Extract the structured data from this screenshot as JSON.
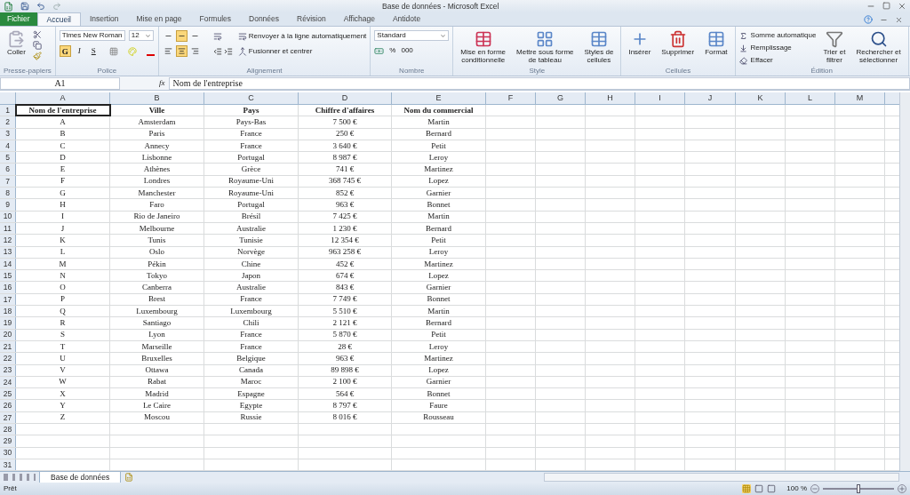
{
  "window": {
    "title": "Base de données - Microsoft Excel"
  },
  "tabs": [
    {
      "label": "Fichier",
      "selected": false,
      "kind": "file"
    },
    {
      "label": "Accueil",
      "selected": true,
      "kind": "tab"
    },
    {
      "label": "Insertion",
      "selected": false,
      "kind": "tab"
    },
    {
      "label": "Mise en page",
      "selected": false,
      "kind": "tab"
    },
    {
      "label": "Formules",
      "selected": false,
      "kind": "tab"
    },
    {
      "label": "Données",
      "selected": false,
      "kind": "tab"
    },
    {
      "label": "Révision",
      "selected": false,
      "kind": "tab"
    },
    {
      "label": "Affichage",
      "selected": false,
      "kind": "tab"
    },
    {
      "label": "Antidote",
      "selected": false,
      "kind": "tab"
    }
  ],
  "ribbon": {
    "clipboard": {
      "title": "Presse-papiers",
      "paste": "Coller"
    },
    "font": {
      "title": "Police",
      "font_name": "Times New Roman",
      "font_size": "12",
      "styles": [
        {
          "label": "G",
          "on": true
        },
        {
          "label": "I",
          "on": false
        },
        {
          "label": "S",
          "on": false
        }
      ]
    },
    "alignment": {
      "title": "Alignement",
      "vertical": [
        {
          "on": false
        },
        {
          "on": true
        },
        {
          "on": false
        }
      ],
      "horizontal": [
        {
          "on": false
        },
        {
          "on": true
        },
        {
          "on": false
        }
      ],
      "wrap": "Renvoyer à la ligne automatiquement",
      "merge": "Fusionner et centrer"
    },
    "number": {
      "title": "Nombre",
      "format": "Standard",
      "percent": "%",
      "thousands": "000"
    },
    "style": {
      "title": "Style",
      "buttons": [
        {
          "lines": [
            "Mise en forme",
            "conditionnelle"
          ]
        },
        {
          "lines": [
            "Mettre sous forme",
            "de tableau"
          ]
        },
        {
          "lines": [
            "Styles de",
            "cellules"
          ]
        }
      ]
    },
    "cells": {
      "title": "Cellules",
      "buttons": [
        "Insérer",
        "Supprimer",
        "Format"
      ]
    },
    "editing": {
      "title": "Édition",
      "small": [
        "Somme automatique",
        "Remplissage",
        "Effacer"
      ],
      "big": [
        {
          "lines": [
            "Trier et",
            "filtrer"
          ]
        },
        {
          "lines": [
            "Rechercher et",
            "sélectionner"
          ]
        }
      ]
    }
  },
  "formula_bar": {
    "name_box": "A1",
    "fx": "fx",
    "value": "Nom de l'entreprise"
  },
  "sheet": {
    "columns": [
      "A",
      "B",
      "C",
      "D",
      "E",
      "F",
      "G",
      "H",
      "I",
      "J",
      "K",
      "L",
      "M"
    ],
    "row_numbers": [
      "1",
      "2",
      "3",
      "4",
      "5",
      "6",
      "7",
      "8",
      "9",
      "10",
      "11",
      "12",
      "13",
      "14",
      "15",
      "16",
      "17",
      "18",
      "19",
      "20",
      "21",
      "22",
      "23",
      "24",
      "25",
      "26",
      "27",
      "28",
      "29",
      "30",
      "31"
    ],
    "rows": [
      [
        "Nom de l'entreprise",
        "Ville",
        "Pays",
        "Chiffre d'affaires",
        "Nom du commercial"
      ],
      [
        "A",
        "Amsterdam",
        "Pays-Bas",
        "7 500 €",
        "Martin"
      ],
      [
        "B",
        "Paris",
        "France",
        "250 €",
        "Bernard"
      ],
      [
        "C",
        "Annecy",
        "France",
        "3 640 €",
        "Petit"
      ],
      [
        "D",
        "Lisbonne",
        "Portugal",
        "8 987 €",
        "Leroy"
      ],
      [
        "E",
        "Athènes",
        "Grèce",
        "741 €",
        "Martinez"
      ],
      [
        "F",
        "Londres",
        "Royaume-Uni",
        "368 745 €",
        "Lopez"
      ],
      [
        "G",
        "Manchester",
        "Royaume-Uni",
        "852 €",
        "Garnier"
      ],
      [
        "H",
        "Faro",
        "Portugal",
        "963 €",
        "Bonnet"
      ],
      [
        "I",
        "Rio de Janeiro",
        "Brésil",
        "7 425 €",
        "Martin"
      ],
      [
        "J",
        "Melbourne",
        "Australie",
        "1 230 €",
        "Bernard"
      ],
      [
        "K",
        "Tunis",
        "Tunisie",
        "12 354 €",
        "Petit"
      ],
      [
        "L",
        "Oslo",
        "Norvège",
        "963 258 €",
        "Leroy"
      ],
      [
        "M",
        "Pékin",
        "Chine",
        "452 €",
        "Martinez"
      ],
      [
        "N",
        "Tokyo",
        "Japon",
        "674 €",
        "Lopez"
      ],
      [
        "O",
        "Canberra",
        "Australie",
        "843 €",
        "Garnier"
      ],
      [
        "P",
        "Brest",
        "France",
        "7 749 €",
        "Bonnet"
      ],
      [
        "Q",
        "Luxembourg",
        "Luxembourg",
        "5 510 €",
        "Martin"
      ],
      [
        "R",
        "Santiago",
        "Chili",
        "2 121 €",
        "Bernard"
      ],
      [
        "S",
        "Lyon",
        "France",
        "5 870 €",
        "Petit"
      ],
      [
        "T",
        "Marseille",
        "France",
        "28 €",
        "Leroy"
      ],
      [
        "U",
        "Bruxelles",
        "Belgique",
        "963 €",
        "Martinez"
      ],
      [
        "V",
        "Ottawa",
        "Canada",
        "89 898 €",
        "Lopez"
      ],
      [
        "W",
        "Rabat",
        "Maroc",
        "2 100 €",
        "Garnier"
      ],
      [
        "X",
        "Madrid",
        "Espagne",
        "564 €",
        "Bonnet"
      ],
      [
        "Y",
        "Le Caire",
        "Egypte",
        "8 797 €",
        "Faure"
      ],
      [
        "Z",
        "Moscou",
        "Russie",
        "8 016 €",
        "Rousseau"
      ]
    ]
  },
  "sheet_tabs": [
    {
      "label": "Base de données",
      "selected": true
    }
  ],
  "status_bar": {
    "status": "Prêt",
    "zoom": "100 %",
    "zoom_slider": {
      "level": 0.5
    }
  }
}
